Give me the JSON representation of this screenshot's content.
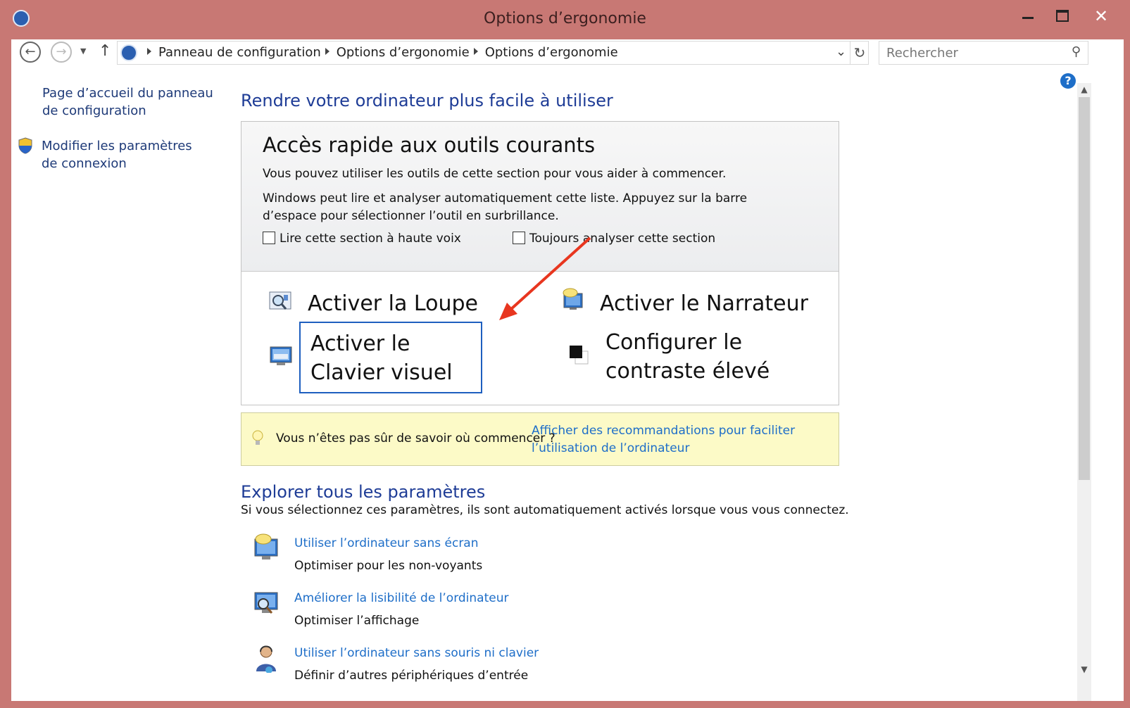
{
  "window": {
    "title": "Options d’ergonomie"
  },
  "address": {
    "crumbs": [
      "Panneau de configuration",
      "Options d’ergonomie",
      "Options d’ergonomie"
    ],
    "search_placeholder": "Rechercher"
  },
  "sidebar": {
    "home_link": "Page d’accueil du panneau de configuration",
    "signin_link": "Modifier les paramètres de connexion"
  },
  "main": {
    "heading": "Rendre votre ordinateur plus facile à utiliser",
    "quick": {
      "title": "Accès rapide aux outils courants",
      "p1": "Vous pouvez utiliser les outils de cette section pour vous aider à commencer.",
      "p2": "Windows peut lire et analyser automatiquement cette liste. Appuyez sur la barre d’espace pour sélectionner l’outil en surbrillance.",
      "check_read": "Lire cette section à haute voix",
      "check_scan": "Toujours analyser cette section",
      "tool_magnifier": "Activer la Loupe",
      "tool_narrator": "Activer le Narrateur",
      "tool_keyboard": "Activer le Clavier visuel",
      "tool_contrast": "Configurer le contraste élevé"
    },
    "hint": {
      "text": "Vous n’êtes pas sûr de savoir où commencer ?",
      "link": "Afficher des recommandations pour faciliter l’utilisation de l’ordinateur"
    },
    "explore": {
      "heading": "Explorer tous les paramètres",
      "subtitle": "Si vous sélectionnez ces paramètres, ils sont automatiquement activés lorsque vous vous connectez.",
      "items": [
        {
          "link": "Utiliser l’ordinateur sans écran",
          "desc": "Optimiser pour les non-voyants"
        },
        {
          "link": "Améliorer la lisibilité de l’ordinateur",
          "desc": "Optimiser l’affichage"
        },
        {
          "link": "Utiliser l’ordinateur sans souris ni clavier",
          "desc": "Définir d’autres périphériques d’entrée"
        }
      ]
    }
  },
  "colors": {
    "link": "#1e6ec8",
    "heading": "#1e3c96",
    "frame": "#c87874",
    "annotation": "#e8361f"
  }
}
